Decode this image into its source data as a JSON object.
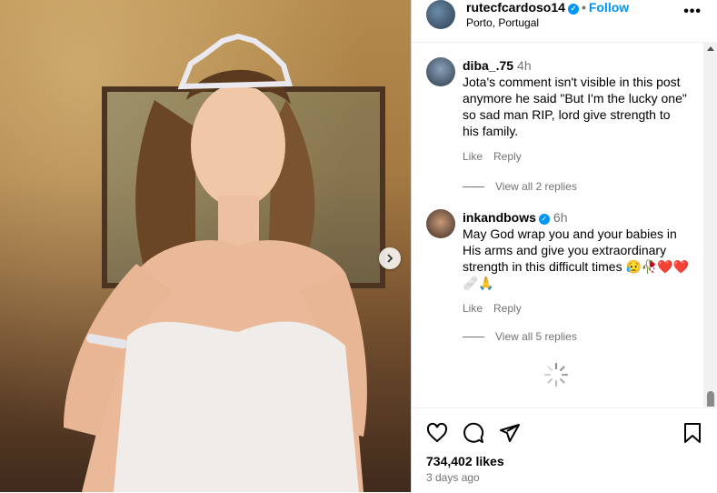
{
  "post": {
    "username": "rutecfcardoso14",
    "follow_label": "Follow",
    "separator": "•",
    "location": "Porto, Portugal",
    "more_label": "•••"
  },
  "comments": [
    {
      "username": "diba_.75",
      "time": "4h",
      "text": "Jota's comment isn't visible in this post anymore he said \"But I'm the lucky one\" so sad man RIP, lord give strength to his family.",
      "like_label": "Like",
      "reply_label": "Reply",
      "view_replies": "View all 2 replies",
      "verified": false
    },
    {
      "username": "inkandbows",
      "time": "6h",
      "text": "May God wrap you and your babies in His arms and give you extraordinary strength in this difficult times 😥🥀❤️❤️🩹🙏",
      "like_label": "Like",
      "reply_label": "Reply",
      "view_replies": "View all 5 replies",
      "verified": true
    }
  ],
  "footer": {
    "likes": "734,402 likes",
    "time_ago": "3 days ago"
  },
  "colors": {
    "accent": "#0095f6",
    "muted": "#737373"
  }
}
